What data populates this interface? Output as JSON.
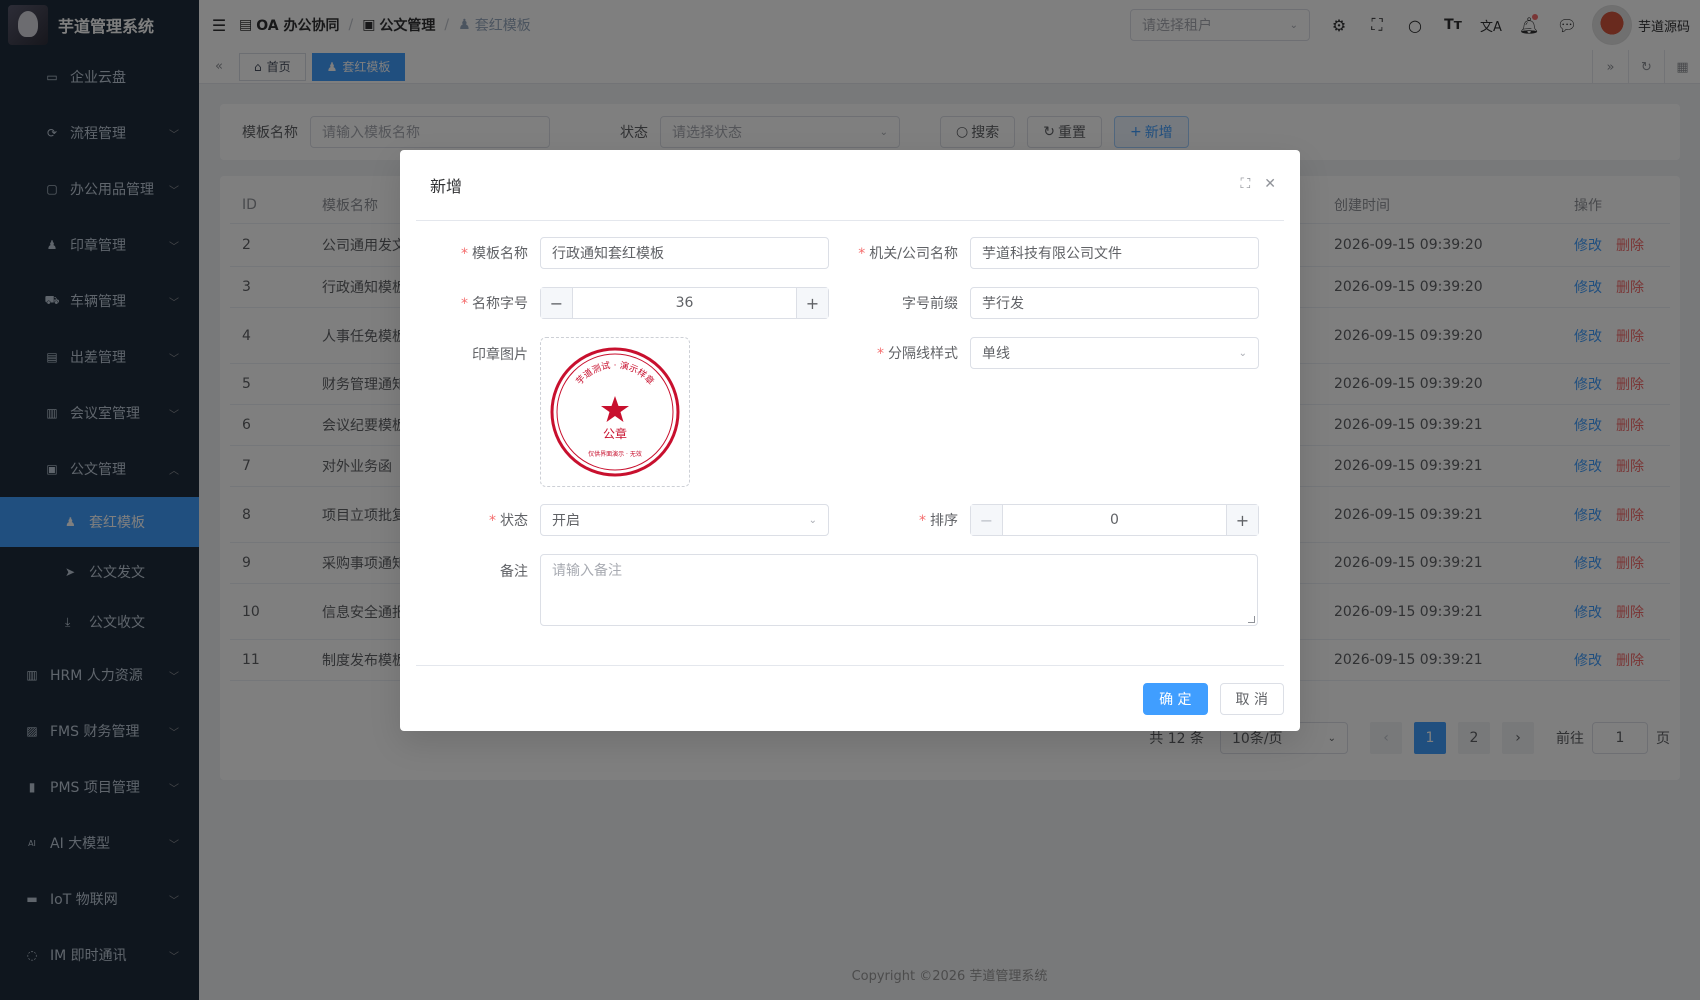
{
  "app": {
    "title": "芋道管理系统"
  },
  "sidebar": {
    "items_top": [
      {
        "label": "企业云盘",
        "icon": "folder-icon"
      },
      {
        "label": "流程管理",
        "icon": "flow-icon",
        "chevron": "down"
      },
      {
        "label": "办公用品管理",
        "icon": "box-icon",
        "chevron": "down"
      },
      {
        "label": "印章管理",
        "icon": "user-icon",
        "chevron": "down"
      },
      {
        "label": "车辆管理",
        "icon": "truck-icon",
        "chevron": "down"
      },
      {
        "label": "出差管理",
        "icon": "briefcase-icon",
        "chevron": "down"
      },
      {
        "label": "会议室管理",
        "icon": "building-icon",
        "chevron": "down"
      },
      {
        "label": "公文管理",
        "icon": "document-icon",
        "chevron": "up"
      }
    ],
    "sub_items": [
      {
        "label": "套红模板",
        "icon": "user-icon",
        "active": true
      },
      {
        "label": "公文发文",
        "icon": "send-icon"
      },
      {
        "label": "公文收文",
        "icon": "download-icon"
      }
    ],
    "items_bottom": [
      {
        "label": "HRM 人力资源",
        "icon": "building-icon"
      },
      {
        "label": "FMS 财务管理",
        "icon": "money-icon"
      },
      {
        "label": "PMS 项目管理",
        "icon": "chart-icon"
      },
      {
        "label": "AI 大模型",
        "icon": "ai-icon"
      },
      {
        "label": "IoT 物联网",
        "icon": "iot-icon"
      },
      {
        "label": "IM 即时通讯",
        "icon": "chat-icon"
      }
    ]
  },
  "navbar": {
    "breadcrumb": [
      "OA 办公协同",
      "公文管理",
      "套红模板"
    ],
    "tenant_placeholder": "请选择租户",
    "user_name": "芋道源码"
  },
  "tags": [
    {
      "label": "首页",
      "icon": "home-icon"
    },
    {
      "label": "套红模板",
      "icon": "user-icon",
      "active": true
    }
  ],
  "search": {
    "name_label": "模板名称",
    "name_placeholder": "请输入模板名称",
    "status_label": "状态",
    "status_placeholder": "请选择状态",
    "search_btn": "搜索",
    "reset_btn": "重置",
    "add_btn": "新增"
  },
  "table": {
    "headers": {
      "id": "ID",
      "name": "模板名称",
      "time": "创建时间",
      "op": "操作"
    },
    "rows": [
      {
        "id": "2",
        "name": "公司通用发文",
        "time": "2026-09-15 09:39:20"
      },
      {
        "id": "3",
        "name": "行政通知模板",
        "time": "2026-09-15 09:39:20"
      },
      {
        "id": "4",
        "name": "人事任免模板",
        "time": "2026-09-15 09:39:20"
      },
      {
        "id": "5",
        "name": "财务管理通知",
        "time": "2026-09-15 09:39:20"
      },
      {
        "id": "6",
        "name": "会议纪要模板",
        "time": "2026-09-15 09:39:21"
      },
      {
        "id": "7",
        "name": "对外业务函",
        "time": "2026-09-15 09:39:21"
      },
      {
        "id": "8",
        "name": "项目立项批复",
        "time": "2026-09-15 09:39:21"
      },
      {
        "id": "9",
        "name": "采购事项通知",
        "time": "2026-09-15 09:39:21"
      },
      {
        "id": "10",
        "name": "信息安全通报",
        "time": "2026-09-15 09:39:21"
      },
      {
        "id": "11",
        "name": "制度发布模板",
        "time": "2026-09-15 09:39:21"
      }
    ],
    "edit_label": "修改",
    "delete_label": "删除"
  },
  "pager": {
    "total": "共 12 条",
    "page_size": "10条/页",
    "pages": [
      "1",
      "2"
    ],
    "current": "1",
    "goto_prefix": "前往",
    "goto_value": "1",
    "goto_suffix": "页"
  },
  "footer": {
    "copyright": "Copyright ©2026 芋道管理系统"
  },
  "dialog": {
    "title": "新增",
    "fields": {
      "template_name": {
        "label": "模板名称",
        "value": "行政通知套红模板",
        "required": true
      },
      "org_name": {
        "label": "机关/公司名称",
        "value": "芋道科技有限公司文件",
        "required": true
      },
      "font_size": {
        "label": "名称字号",
        "value": "36",
        "required": true
      },
      "prefix": {
        "label": "字号前缀",
        "value": "芋行发"
      },
      "seal": {
        "label": "印章图片",
        "seal_top_text": "芋道测试 · 演示样章",
        "seal_center": "公章",
        "seal_bottom_text": "仅供界面演示 · 无效"
      },
      "divider_style": {
        "label": "分隔线样式",
        "value": "单线",
        "required": true
      },
      "status": {
        "label": "状态",
        "value": "开启",
        "required": true
      },
      "sort": {
        "label": "排序",
        "value": "0",
        "required": true
      },
      "remark": {
        "label": "备注",
        "placeholder": "请输入备注"
      }
    },
    "confirm_btn": "确 定",
    "cancel_btn": "取 消"
  },
  "colors": {
    "primary": "#409eff",
    "danger": "#f56c6c",
    "sidebar": "#1f2d3d",
    "seal": "#c8102e"
  }
}
